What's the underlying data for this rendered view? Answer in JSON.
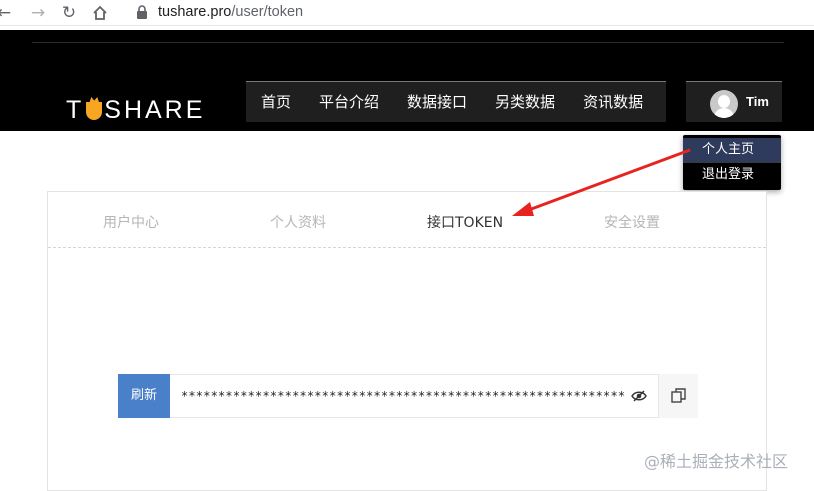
{
  "browser": {
    "url_host": "tushare.pro",
    "url_path": "/user/token"
  },
  "header": {
    "logo_left": "T",
    "logo_right": "SHARE",
    "nav": [
      "首页",
      "平台介绍",
      "数据接口",
      "另类数据",
      "资讯数据"
    ],
    "user": {
      "name": "Tim",
      "menu": [
        "个人主页",
        "退出登录"
      ]
    }
  },
  "tabs": [
    "用户中心",
    "个人资料",
    "接口TOKEN",
    "安全设置"
  ],
  "active_tab": "接口TOKEN",
  "token_panel": {
    "refresh_label": "刷新",
    "token_masked": "************************************************************"
  },
  "watermark": "@稀土掘金技术社区",
  "colors": {
    "header_bg": "#000000",
    "logo_accent": "#f6a623",
    "refresh_bg": "#4a7fc9",
    "annotation_arrow": "#e8231f",
    "dropdown_active": "#2f3b5c"
  },
  "icons": [
    "back-arrow-icon",
    "forward-arrow-icon",
    "reload-icon",
    "home-icon",
    "lock-icon",
    "eye-slash-icon",
    "copy-icon"
  ]
}
